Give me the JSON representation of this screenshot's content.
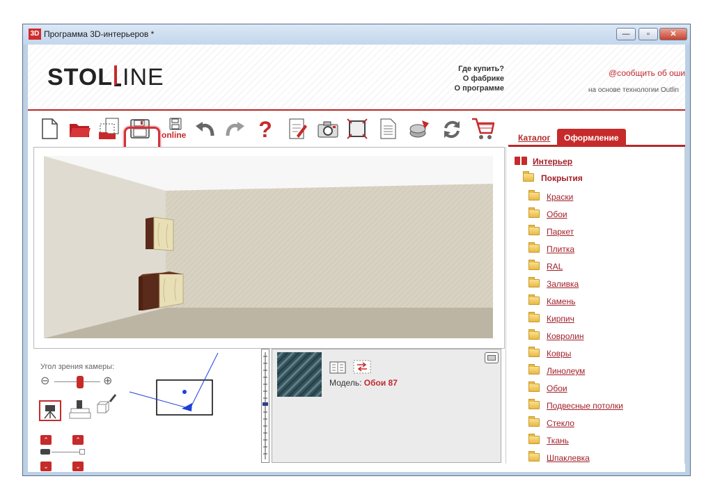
{
  "window": {
    "title": "Программа 3D-интерьеров *",
    "app_icon": "3D",
    "buttons": {
      "minimize": "—",
      "maximize": "▫",
      "close": "✕"
    }
  },
  "header": {
    "logo_bold": "STOL",
    "logo_thin": "INE",
    "links": [
      "Где купить?",
      "О фабрике",
      "О программе"
    ],
    "report_link": "@сообщить об оши",
    "tech_text": "на основе технологии Outlin"
  },
  "toolbar": {
    "online_label": "online",
    "buttons": [
      "new-file",
      "open-folder",
      "save-to-dialog",
      "save",
      "save-online",
      "undo",
      "redo",
      "help",
      "edit-document",
      "camera",
      "frame",
      "report",
      "materials",
      "refresh",
      "cart"
    ]
  },
  "tabs": {
    "catalog": "Каталог",
    "design": "Оформление"
  },
  "camera": {
    "label": "Угол зрения камеры:",
    "zoom_out": "⊖",
    "zoom_in": "⊕"
  },
  "preview": {
    "model_label": "Модель:",
    "model_value": "Обои 87"
  },
  "catalog": {
    "root": "Интерьер",
    "group": "Покрытия",
    "items": [
      "Краски",
      "Обои",
      "Паркет",
      "Плитка",
      "RAL",
      "Заливка",
      "Камень",
      "Кирпич",
      "Ковролин",
      "Ковры",
      "Линолеум",
      "Обои",
      "Подвесные потолки",
      "Стекло",
      "Ткань",
      "Шпаклевка"
    ]
  },
  "colors": {
    "accent": "#c62a2a",
    "link": "#a2202a",
    "wall": "#d9d3c5",
    "floor": "#bdb5a4"
  }
}
